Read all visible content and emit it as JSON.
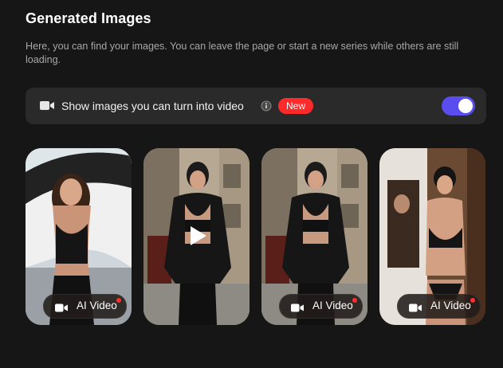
{
  "header": {
    "title": "Generated Images",
    "description": "Here, you can find your images. You can leave the page or start a new series while others are still loading."
  },
  "filter": {
    "label": "Show images you can turn into video",
    "badge": "New",
    "toggle_on": true,
    "icon": "video-camera-icon"
  },
  "cards": [
    {
      "button_label": "AI Video",
      "has_play": false
    },
    {
      "button_label": "",
      "has_play": true
    },
    {
      "button_label": "AI Video",
      "has_play": false
    },
    {
      "button_label": "AI Video",
      "has_play": false
    }
  ],
  "colors": {
    "background": "#161616",
    "panel": "#2a2a2a",
    "accent": "#5a4df0",
    "badge": "#ff2b2b"
  }
}
